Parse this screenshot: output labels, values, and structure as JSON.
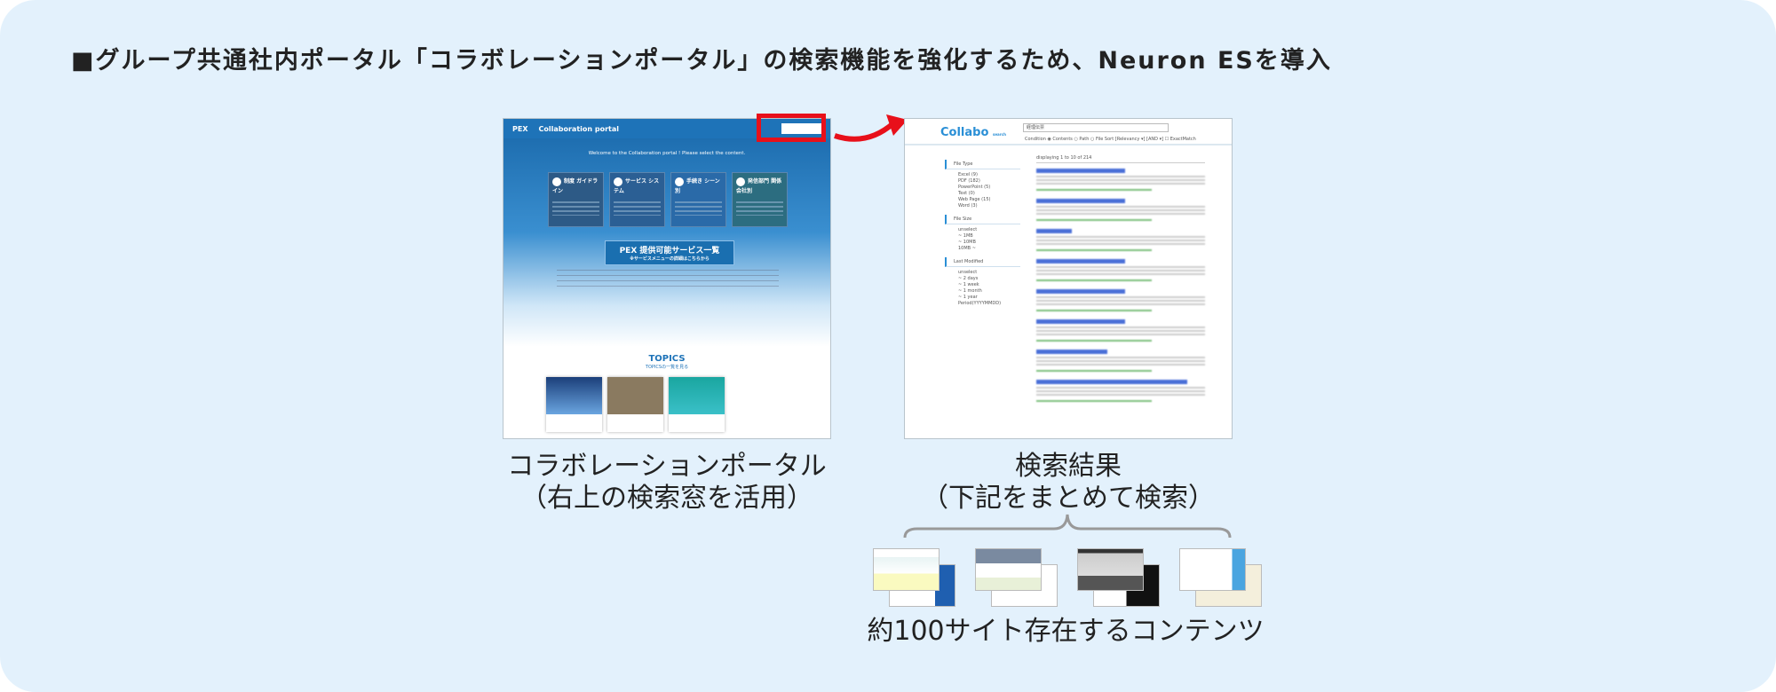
{
  "title": "■グループ共通社内ポータル「コラボレーションポータル」の検索機能を強化するため、Neuron ESを導入",
  "portal": {
    "logo": "PEX",
    "name": "Collaboration portal",
    "welcome": "Welcome to the Collaboration portal ! Please select the content.",
    "cards": [
      {
        "label": "制度 ガイドライン"
      },
      {
        "label": "サービス システム"
      },
      {
        "label": "手続き シーン別"
      },
      {
        "label": "発信部門 関係会社別"
      }
    ],
    "service_button": "PEX 提供可能サービス一覧",
    "service_sub": "※サービスメニューの詳細はこちらから",
    "topics": "TOPICS",
    "topics_link": "TOPICSの一覧を見る"
  },
  "search": {
    "logo": "Collabo",
    "logo_sub": "search",
    "query": "経理伝票",
    "condition": "Condition ◉ Contents ○ Path ○ File  Sort [Relevancy ▾] [AND ▾] ☐ ExactMatch",
    "count": "displaying 1 to 10 of 214",
    "file_type_label": "File Type",
    "file_types": [
      "Excel (9)",
      "PDF (182)",
      "PowerPoint (5)",
      "Text (0)",
      "Web Page (15)",
      "Word (3)"
    ],
    "file_size_label": "File Size",
    "file_sizes": [
      "unselect",
      "~ 1MB",
      "~ 10MB",
      "10MB ~"
    ],
    "last_modified_label": "Last Modified",
    "last_modified": [
      "unselect",
      "~ 2 days",
      "~ 1 week",
      "~ 1 month",
      "~ 1 year",
      "Period(YYYYMMDD)"
    ]
  },
  "captions": {
    "portal_line1": "コラボレーションポータル",
    "portal_line2": "（右上の検索窓を活用）",
    "search_line1": "検索結果",
    "search_line2": "（下記をまとめて検索）",
    "sites": "約100サイト存在するコンテンツ"
  },
  "colors": {
    "background": "#e3f1fc",
    "highlight": "#e8101a",
    "portal_blue": "#1e73b8"
  }
}
